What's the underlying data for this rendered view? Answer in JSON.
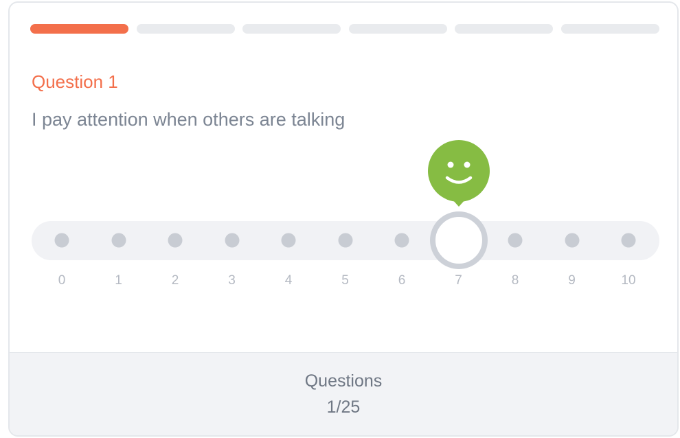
{
  "progress": {
    "total_segments": 6,
    "completed_segments": 1,
    "active_color": "#f36f4b",
    "inactive_color": "#e9ebee"
  },
  "question": {
    "label": "Question 1",
    "text": "I pay attention when others are talking"
  },
  "scale": {
    "labels": [
      "0",
      "1",
      "2",
      "3",
      "4",
      "5",
      "6",
      "7",
      "8",
      "9",
      "10"
    ],
    "selected_value": 7,
    "feedback_icon": "smiley-face-icon",
    "feedback_color": "#86bc43"
  },
  "footer": {
    "title": "Questions",
    "count": "1/25"
  }
}
